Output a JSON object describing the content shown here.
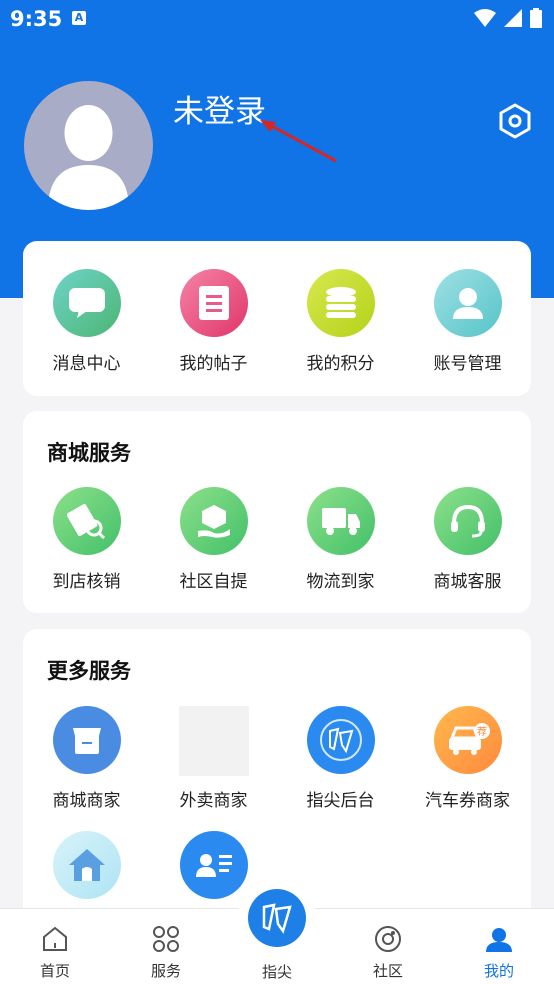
{
  "status": {
    "time": "9:35"
  },
  "header": {
    "login_status": "未登录"
  },
  "quick_actions": [
    {
      "label": "消息中心",
      "icon": "chat-bubble-icon"
    },
    {
      "label": "我的帖子",
      "icon": "document-icon"
    },
    {
      "label": "我的积分",
      "icon": "coins-icon"
    },
    {
      "label": "账号管理",
      "icon": "user-icon"
    }
  ],
  "mall_services": {
    "title": "商城服务",
    "items": [
      {
        "label": "到店核销",
        "icon": "ticket-icon"
      },
      {
        "label": "社区自提",
        "icon": "package-hand-icon"
      },
      {
        "label": "物流到家",
        "icon": "truck-icon"
      },
      {
        "label": "商城客服",
        "icon": "headset-icon"
      }
    ]
  },
  "more_services": {
    "title": "更多服务",
    "items": [
      {
        "label": "商城商家",
        "icon": "store-icon"
      },
      {
        "label": "外卖商家",
        "icon": "blank-placeholder"
      },
      {
        "label": "指尖后台",
        "icon": "app-logo-icon"
      },
      {
        "label": "汽车券商家",
        "icon": "car-coupon-icon"
      },
      {
        "label": "",
        "icon": "house-icon"
      },
      {
        "label": "",
        "icon": "id-card-icon"
      }
    ]
  },
  "tabbar": [
    {
      "label": "首页",
      "icon": "home-icon"
    },
    {
      "label": "服务",
      "icon": "grid-icon"
    },
    {
      "label": "指尖",
      "icon": "app-logo-icon"
    },
    {
      "label": "社区",
      "icon": "community-icon"
    },
    {
      "label": "我的",
      "icon": "profile-icon"
    }
  ],
  "colors": {
    "primary": "#1073e6",
    "background": "#f4f4f6"
  }
}
